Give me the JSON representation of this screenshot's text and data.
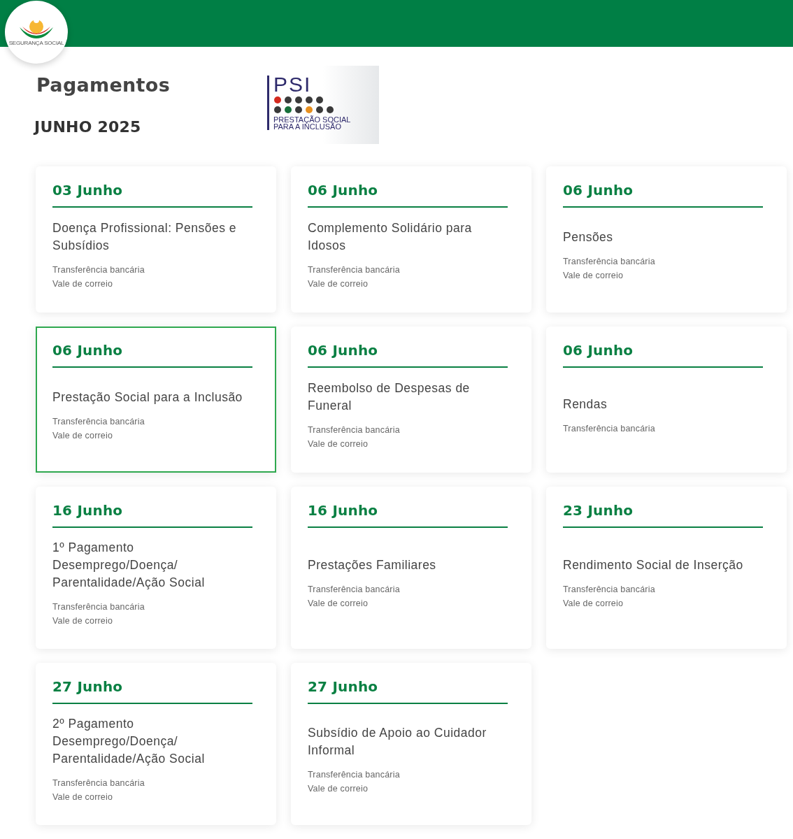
{
  "header": {
    "logo_text": "SEGURANÇA SOCIAL"
  },
  "title": "Pagamentos",
  "month": "JUNHO 2025",
  "psi_logo": {
    "acronym": "PSI",
    "line_1": "PRESTAÇÃO SOCIAL",
    "line_2": "PARA A INCLUSÃO"
  },
  "payments": [
    {
      "date": "03 Junho",
      "title": "Doença Profissional: Pensões e Subsídios",
      "methods": [
        "Transferência bancária",
        "Vale de correio"
      ],
      "selected": false
    },
    {
      "date": "06 Junho",
      "title": "Complemento Solidário para Idosos",
      "methods": [
        "Transferência bancária",
        "Vale de correio"
      ],
      "selected": false
    },
    {
      "date": "06 Junho",
      "title": "Pensões",
      "methods": [
        "Transferência bancária",
        "Vale de correio"
      ],
      "selected": false
    },
    {
      "date": "06 Junho",
      "title": "Prestação Social para a Inclusão",
      "methods": [
        "Transferência bancária",
        "Vale de correio"
      ],
      "selected": true
    },
    {
      "date": "06 Junho",
      "title": "Reembolso de Despesas de Funeral",
      "methods": [
        "Transferência bancária",
        "Vale de correio"
      ],
      "selected": false
    },
    {
      "date": "06 Junho",
      "title": "Rendas",
      "methods": [
        "Transferência bancária"
      ],
      "selected": false
    },
    {
      "date": "16 Junho",
      "title": "1º Pagamento Desemprego/Doença/ Parentalidade/Ação Social",
      "methods": [
        "Transferência bancária",
        "Vale de correio"
      ],
      "selected": false
    },
    {
      "date": "16 Junho",
      "title": "Prestações Familiares",
      "methods": [
        "Transferência bancária",
        "Vale de correio"
      ],
      "selected": false
    },
    {
      "date": "23 Junho",
      "title": "Rendimento Social de Inserção",
      "methods": [
        "Transferência bancária",
        "Vale de correio"
      ],
      "selected": false
    },
    {
      "date": "27 Junho",
      "title": "2º Pagamento Desemprego/Doença/ Parentalidade/Ação Social",
      "methods": [
        "Transferência bancária",
        "Vale de correio"
      ],
      "selected": false
    },
    {
      "date": "27 Junho",
      "title": "Subsídio de Apoio ao Cuidador Informal",
      "methods": [
        "Transferência bancária",
        "Vale de correio"
      ],
      "selected": false
    }
  ]
}
